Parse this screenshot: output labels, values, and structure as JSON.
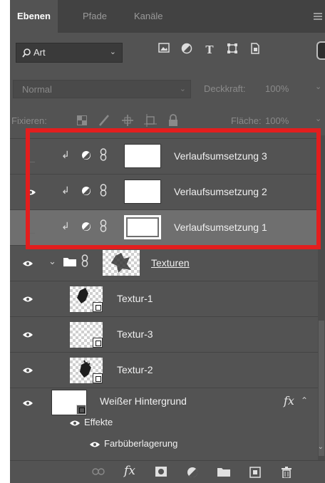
{
  "tabs": [
    {
      "label": "Ebenen",
      "active": true
    },
    {
      "label": "Pfade",
      "active": false
    },
    {
      "label": "Kanäle",
      "active": false
    }
  ],
  "filter": {
    "label": "Art",
    "icons": [
      "image-filter-icon",
      "adjustment-filter-icon",
      "type-filter-icon",
      "shape-filter-icon",
      "smart-object-filter-icon"
    ]
  },
  "blend": {
    "mode": "Normal",
    "opacity_label": "Deckkraft:",
    "opacity_value": "100%"
  },
  "lock": {
    "label": "Fixieren:",
    "fill_label": "Fläche:",
    "fill_value": "100%"
  },
  "layers": {
    "adj3": "Verlaufsumsetzung 3",
    "adj2": "Verlaufsumsetzung 2",
    "adj1": "Verlaufsumsetzung 1",
    "group": "Texturen",
    "t1": "Textur-1",
    "t3": "Textur-3",
    "t2": "Textur-2",
    "bg": "Weißer Hintergrund",
    "effects": "Effekte",
    "color_overlay": "Farbüberlagerung"
  },
  "fx_badge": "fx",
  "colors": {
    "panel": "#535353",
    "tabbar": "#424242",
    "selected": "#6f6f6f",
    "highlight": "#e31e1e"
  }
}
